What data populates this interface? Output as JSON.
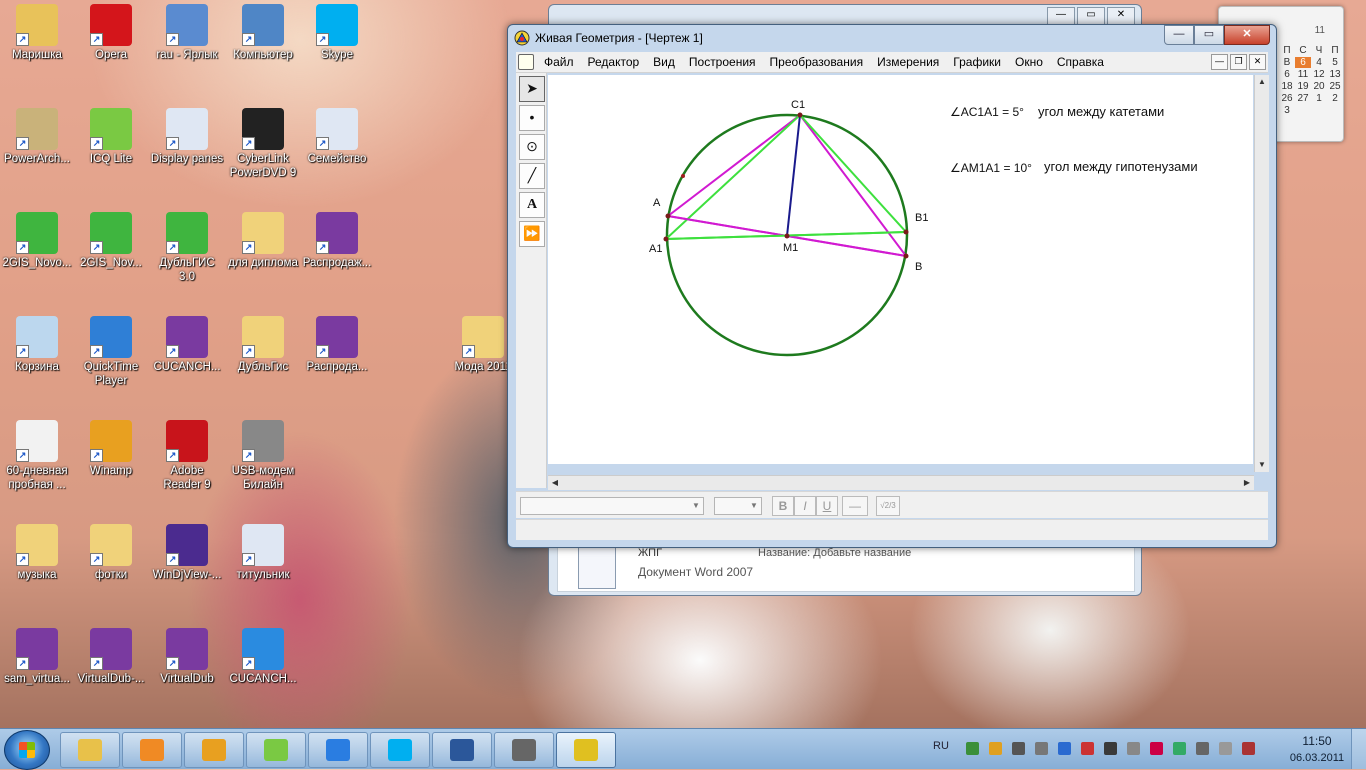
{
  "desktop": {
    "icons": [
      {
        "label": "Маришка",
        "icon": "user-folder-icon"
      },
      {
        "label": "Opera",
        "icon": "opera-icon"
      },
      {
        "label": "rau - Ярлык",
        "icon": "network-icon"
      },
      {
        "label": "Компьютер",
        "icon": "computer-icon"
      },
      {
        "label": "Skype",
        "icon": "skype-icon"
      },
      {
        "label": "PowerArch...",
        "icon": "archive-icon"
      },
      {
        "label": "ICQ Lite",
        "icon": "icq-icon"
      },
      {
        "label": "Display panes",
        "icon": "document-icon"
      },
      {
        "label": "CyberLink PowerDVD 9",
        "icon": "dvd-icon"
      },
      {
        "label": "Семейство",
        "icon": "word-doc-icon"
      },
      {
        "label": "2GIS_Novo...",
        "icon": "2gis-icon"
      },
      {
        "label": "2GIS_Nov...",
        "icon": "2gis-icon"
      },
      {
        "label": "ДубльГИС 3.0",
        "icon": "2gis-icon"
      },
      {
        "label": "для диплома",
        "icon": "folder-icon"
      },
      {
        "label": "Распродаж...",
        "icon": "winrar-icon"
      },
      {
        "label": "Корзина",
        "icon": "recycle-bin-icon"
      },
      {
        "label": "QuickTime Player",
        "icon": "quicktime-icon"
      },
      {
        "label": "CUCANCH...",
        "icon": "winrar-icon"
      },
      {
        "label": "ДубльГис",
        "icon": "folder-icon"
      },
      {
        "label": "Распрода...",
        "icon": "winrar-icon"
      },
      {
        "label": "Мода 2011",
        "icon": "folder-icon"
      },
      {
        "label": "60-дневная пробная ...",
        "icon": "office-trial-icon"
      },
      {
        "label": "Winamp",
        "icon": "winamp-icon"
      },
      {
        "label": "Adobe Reader 9",
        "icon": "adobe-reader-icon"
      },
      {
        "label": "USB-модем Билайн",
        "icon": "usb-modem-icon"
      },
      {
        "label": "музыка",
        "icon": "folder-icon"
      },
      {
        "label": "фотки",
        "icon": "folder-icon"
      },
      {
        "label": "WinDjView-...",
        "icon": "windjview-icon"
      },
      {
        "label": "титульник",
        "icon": "word-doc-icon"
      },
      {
        "label": "sam_virtua...",
        "icon": "winrar-icon"
      },
      {
        "label": "VirtualDub-...",
        "icon": "winrar-icon"
      },
      {
        "label": "VirtualDub",
        "icon": "winrar-icon"
      },
      {
        "label": "CUCANCH...",
        "icon": "globe-icon"
      }
    ]
  },
  "calendar": {
    "header": "11",
    "days": [
      "П",
      "С",
      "Ч",
      "П",
      "В",
      "4",
      "5",
      "6",
      "11",
      "12",
      "13",
      "18",
      "19",
      "20",
      "25",
      "26",
      "27",
      "1",
      "2",
      "3"
    ],
    "today": "6"
  },
  "background_window": {
    "doc_name": "ЖПГ",
    "title_label": "Название: Добавьте название",
    "doc_type": "Документ Word 2007"
  },
  "app": {
    "title": "Живая Геометрия - [Чертеж 1]",
    "menu": [
      "Файл",
      "Редактор",
      "Вид",
      "Построения",
      "Преобразования",
      "Измерения",
      "Графики",
      "Окно",
      "Справка"
    ],
    "tools": [
      {
        "name": "arrow-tool-icon",
        "glyph": "➤"
      },
      {
        "name": "point-tool-icon",
        "glyph": "•"
      },
      {
        "name": "compass-tool-icon",
        "glyph": "⊙"
      },
      {
        "name": "line-tool-icon",
        "glyph": "╱"
      },
      {
        "name": "text-tool-icon",
        "glyph": "A"
      },
      {
        "name": "custom-tool-icon",
        "glyph": "⏩"
      }
    ],
    "points": {
      "C1": {
        "label": "C1"
      },
      "A": {
        "label": "A"
      },
      "A1": {
        "label": "A1"
      },
      "M1": {
        "label": "M1"
      },
      "B1": {
        "label": "B1"
      },
      "B": {
        "label": "B"
      }
    },
    "measurements": [
      {
        "label": "∠AC1A1 = 5°",
        "caption": "угол между катетами"
      },
      {
        "label": "∠AM1A1 = 10°",
        "caption": "угол между гипотенузами"
      }
    ],
    "format_bar": {
      "bold": "B",
      "italic": "I",
      "underline": "U",
      "dash": "—",
      "fraction": "√2/3"
    },
    "colors": {
      "circle": "#1e7a1e",
      "magenta": "#d11ad1",
      "green": "#3ee03e",
      "blue": "#1a1a8c"
    }
  },
  "taskbar": {
    "items": [
      {
        "name": "explorer",
        "icon": "explorer-icon",
        "color": "#e8c14a"
      },
      {
        "name": "media-player",
        "icon": "media-player-icon",
        "color": "#f08a24"
      },
      {
        "name": "winamp",
        "icon": "winamp-icon",
        "color": "#e8a020"
      },
      {
        "name": "icq",
        "icon": "icq-icon",
        "color": "#7ac943"
      },
      {
        "name": "internet-explorer",
        "icon": "ie-icon",
        "color": "#2a7de1"
      },
      {
        "name": "skype",
        "icon": "skype-icon",
        "color": "#00aff0"
      },
      {
        "name": "word",
        "icon": "word-icon",
        "color": "#2b579a"
      },
      {
        "name": "usb-modem",
        "icon": "usb-modem-icon",
        "color": "#666666"
      },
      {
        "name": "live-geometry",
        "icon": "live-geometry-icon",
        "color": "#e0c020"
      }
    ],
    "language": "RU",
    "time": "11:50",
    "date": "06.03.2011"
  }
}
